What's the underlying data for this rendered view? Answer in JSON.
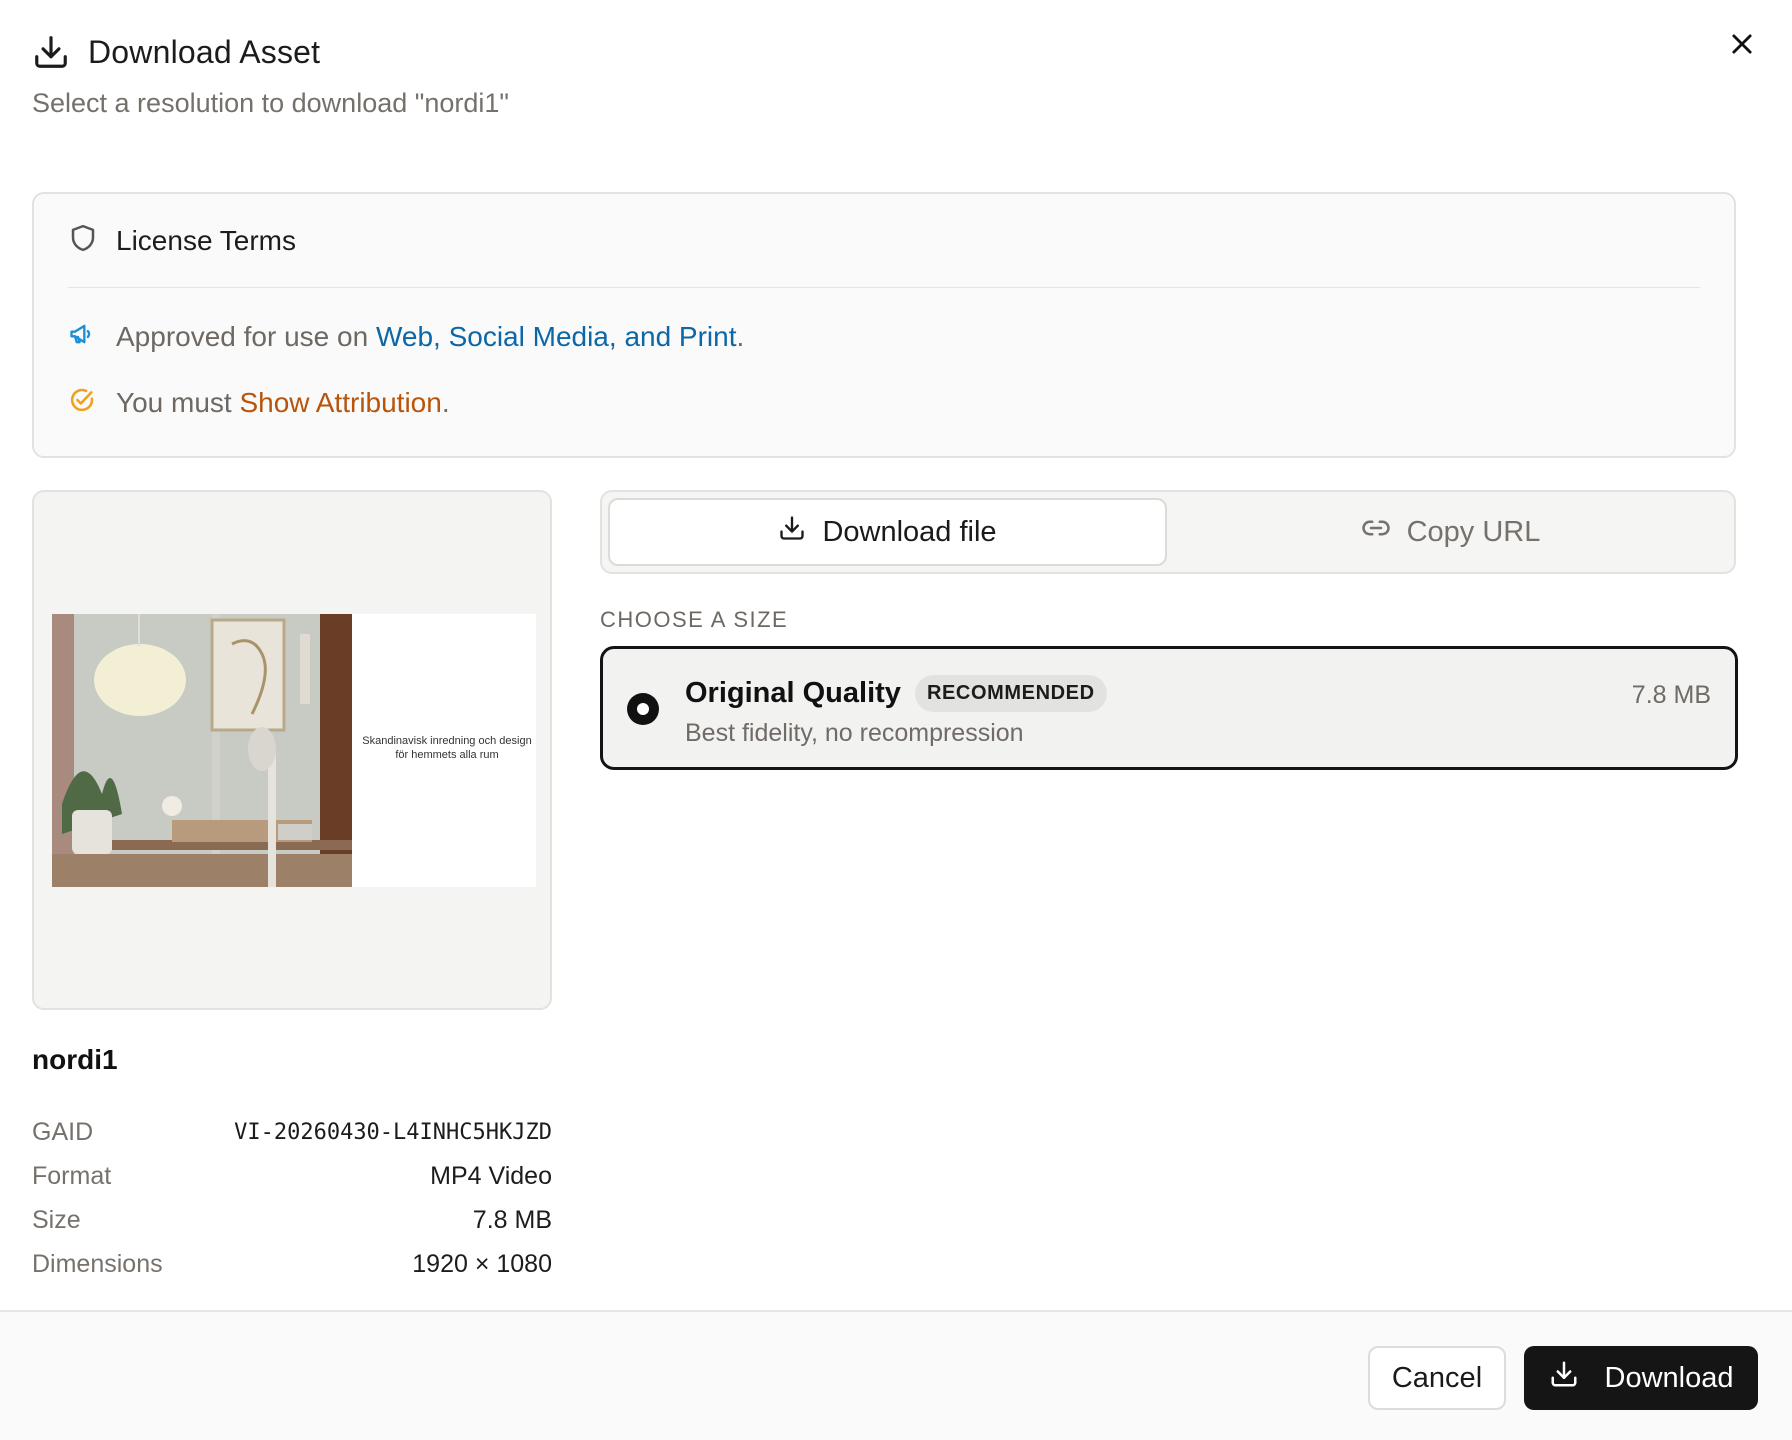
{
  "dialog": {
    "title": "Download Asset",
    "subtitle": "Select a resolution to download \"nordi1\"",
    "title_icon": "download-icon",
    "close_icon": "close-icon"
  },
  "license": {
    "title": "License Terms",
    "icon": "shield-icon",
    "approved_prefix": "Approved for use on ",
    "approved_highlight": "Web, Social Media, and Print",
    "approved_suffix": ".",
    "approved_icon": "megaphone-icon",
    "attribution_prefix": "You must ",
    "attribution_highlight": "Show Attribution",
    "attribution_suffix": ".",
    "attribution_icon": "check-circle-icon",
    "colors": {
      "blue": "#0b67a8",
      "orange": "#b8540b",
      "icon_blue": "#1a8fd6",
      "icon_orange": "#f0a020"
    }
  },
  "preview": {
    "thumb_caption": "Skandinavisk inredning och design för hemmets alla rum"
  },
  "asset": {
    "name": "nordi1",
    "meta": [
      {
        "key": "GAID",
        "value": "VI-20260430-L4INHC5HKJZD"
      },
      {
        "key": "Format",
        "value": "MP4 Video"
      },
      {
        "key": "Size",
        "value": "7.8 MB"
      },
      {
        "key": "Dimensions",
        "value": "1920 × 1080"
      }
    ]
  },
  "tabs": {
    "download_file": "Download file",
    "copy_url": "Copy URL",
    "active": "download_file"
  },
  "sizes": {
    "label": "CHOOSE A SIZE",
    "options": [
      {
        "title": "Original Quality",
        "badge": "RECOMMENDED",
        "description": "Best fidelity, no recompression",
        "size": "7.8 MB",
        "selected": true
      }
    ]
  },
  "footer": {
    "cancel": "Cancel",
    "download": "Download"
  }
}
